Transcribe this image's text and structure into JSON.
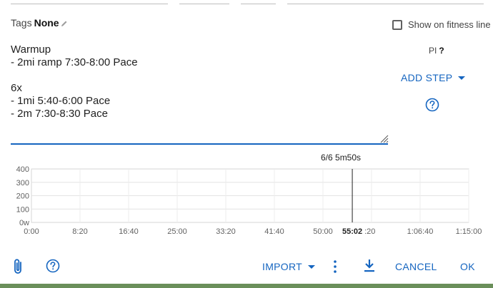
{
  "tags": {
    "label": "Tags",
    "value": "None"
  },
  "show_fitness": {
    "label": "Show on fitness line",
    "checked": false
  },
  "workout": {
    "text": "Warmup\n- 2mi ramp 7:30-8:00 Pace\n\n6x\n- 1mi 5:40-6:00 Pace\n- 2m 7:30-8:30 Pace"
  },
  "pi": {
    "label": "PI",
    "value": "?"
  },
  "add_step": {
    "label": "ADD STEP"
  },
  "chart_data": {
    "type": "line",
    "y_ticks": [
      "400",
      "300",
      "200",
      "100",
      "0w"
    ],
    "ylim": [
      0,
      400
    ],
    "x_ticks": [
      "0:00",
      "8:20",
      "16:40",
      "25:00",
      "33:20",
      "41:40",
      "50:00",
      "58:20",
      "1:06:40",
      "1:15:00"
    ],
    "x_ticks_display": [
      "0:00",
      "8:20",
      "16:40",
      "25:00",
      "33:20",
      "41:40",
      "50:00",
      "",
      "1:06:40",
      "1:15:00"
    ],
    "xlim_seconds": [
      0,
      4500
    ],
    "cursor": {
      "x_label": "55:02",
      "x_seconds": 3302,
      "label": "6/6  5m50s"
    },
    "grid": true
  },
  "bottom": {
    "import_label": "IMPORT",
    "cancel_label": "CANCEL",
    "ok_label": "OK"
  },
  "colors": {
    "accent": "#1565c0"
  }
}
